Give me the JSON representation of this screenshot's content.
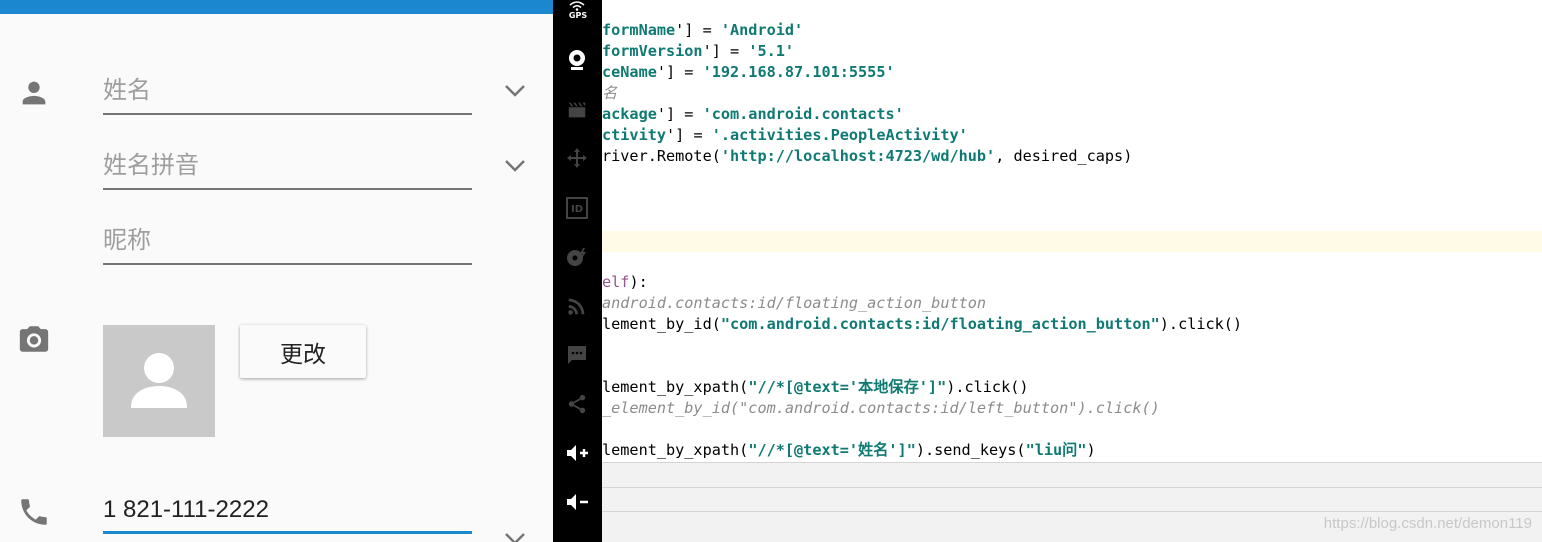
{
  "android": {
    "fields": {
      "name_placeholder": "姓名",
      "pinyin_placeholder": "姓名拼音",
      "nickname_placeholder": "昵称"
    },
    "change_button_label": "更改",
    "phone_value": "1 821-111-2222"
  },
  "toolbar": {
    "gps_label": "GPS"
  },
  "editor": {
    "lines": [
      {
        "parts": [
          {
            "t": "formName",
            "c": "s"
          },
          {
            "t": "'] = ",
            "c": ""
          },
          {
            "t": "'Android'",
            "c": "s"
          }
        ]
      },
      {
        "parts": [
          {
            "t": "formVersion",
            "c": "s"
          },
          {
            "t": "'] = ",
            "c": ""
          },
          {
            "t": "'5.1'",
            "c": "s"
          }
        ]
      },
      {
        "parts": [
          {
            "t": "ceName",
            "c": "s"
          },
          {
            "t": "'] = ",
            "c": ""
          },
          {
            "t": "'192.168.87.101:5555'",
            "c": "s"
          }
        ]
      },
      {
        "parts": [
          {
            "t": "名",
            "c": "cm"
          }
        ]
      },
      {
        "parts": [
          {
            "t": "ackage",
            "c": "s"
          },
          {
            "t": "'] = ",
            "c": ""
          },
          {
            "t": "'com.android.contacts'",
            "c": "s"
          }
        ]
      },
      {
        "parts": [
          {
            "t": "ctivity",
            "c": "s"
          },
          {
            "t": "'] = ",
            "c": ""
          },
          {
            "t": "'.activities.PeopleActivity'",
            "c": "s"
          }
        ]
      },
      {
        "parts": [
          {
            "t": "river.Remote(",
            "c": ""
          },
          {
            "t": "'http://localhost:4723/wd/hub'",
            "c": "s"
          },
          {
            "t": ", desired_caps)",
            "c": ""
          }
        ]
      },
      {
        "parts": []
      },
      {
        "parts": []
      },
      {
        "parts": []
      },
      {
        "parts": []
      },
      {
        "parts": []
      },
      {
        "parts": [
          {
            "t": "elf",
            "c": "kw"
          },
          {
            "t": "):",
            "c": ""
          }
        ]
      },
      {
        "parts": [
          {
            "t": "android.contacts:id/floating_action_button",
            "c": "cm"
          }
        ]
      },
      {
        "parts": [
          {
            "t": "lement_by_id(",
            "c": ""
          },
          {
            "t": "\"com.android.contacts:id/floating_action_button\"",
            "c": "s"
          },
          {
            "t": ").click()",
            "c": ""
          }
        ]
      },
      {
        "parts": []
      },
      {
        "parts": []
      },
      {
        "parts": [
          {
            "t": "lement_by_xpath(",
            "c": ""
          },
          {
            "t": "\"//*[@text='本地保存']\"",
            "c": "s"
          },
          {
            "t": ").click()",
            "c": ""
          }
        ]
      },
      {
        "parts": [
          {
            "t": "_element_by_id(\"com.android.contacts:id/left_button\").click()",
            "c": "cm"
          }
        ]
      },
      {
        "parts": []
      },
      {
        "parts": [
          {
            "t": "lement_by_xpath(",
            "c": ""
          },
          {
            "t": "\"//*[@text='姓名']\"",
            "c": "s"
          },
          {
            "t": ").send_keys(",
            "c": ""
          },
          {
            "t": "\"liu问\"",
            "c": "s"
          },
          {
            "t": ")",
            "c": ""
          }
        ]
      }
    ]
  },
  "watermark": "https://blog.csdn.net/demon119"
}
